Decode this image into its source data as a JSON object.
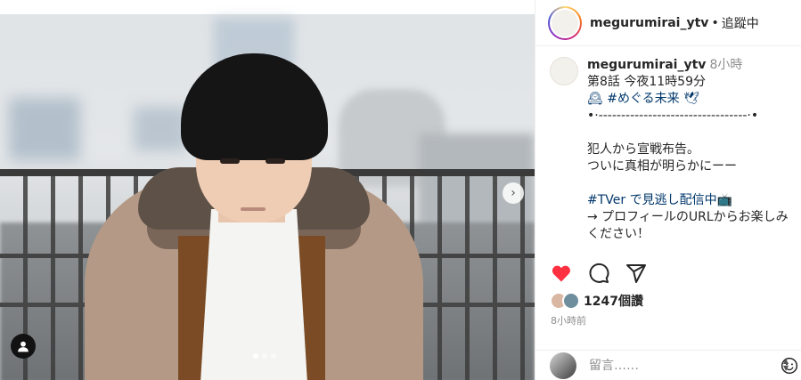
{
  "post": {
    "username": "megurumirai_ytv",
    "separator": "•",
    "follow_status": "追蹤中",
    "logo_text": "めぐる未来"
  },
  "caption": {
    "username": "megurumirai_ytv",
    "time": "8小時",
    "lines": [
      "第8話 今夜11時59分",
      "🕰 #めぐる未来 🕊",
      "•·---------------------------------·•",
      "",
      "犯人から宣戦布告。",
      "ついに真相が明らかにーー",
      "",
      "#TVer で見逃し配信中📺",
      "→ プロフィールのURLからお楽しみ",
      "ください！"
    ]
  },
  "actions": {
    "like_icon": "heart-filled-icon",
    "comment_icon": "comment-icon",
    "share_icon": "share-icon",
    "like_color": "#ff3040"
  },
  "likes": {
    "count_label": "1247個讚"
  },
  "posted_time": "8小時前",
  "comment": {
    "placeholder": "留言……"
  },
  "carousel": {
    "total_slides": 3,
    "active_slide": 1
  }
}
